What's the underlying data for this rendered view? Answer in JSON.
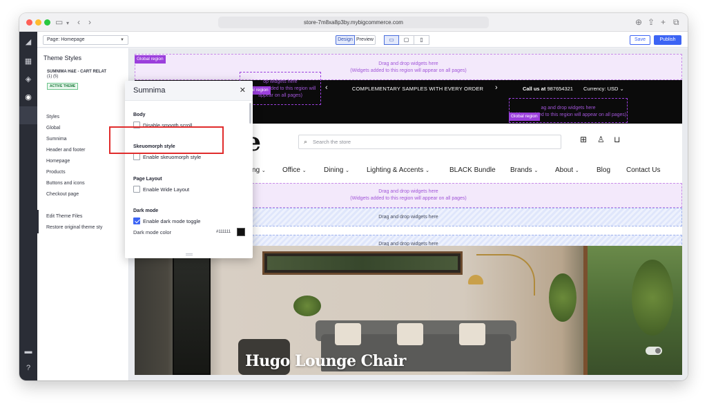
{
  "browser": {
    "url": "store-7m8xa8p3by.mybigcommerce.com"
  },
  "toolbar": {
    "page_select": "Page: Homepage",
    "design_label": "Design",
    "preview_label": "Preview",
    "save_label": "Save",
    "publish_label": "Publish"
  },
  "sidebar": {
    "title": "Theme Styles",
    "theme_name": "SUMNIMA H&E - CART RELAT",
    "theme_version": "(1) (5)",
    "active_badge": "ACTIVE THEME",
    "items": [
      "Styles",
      "Global",
      "Sumnima",
      "Header and footer",
      "Homepage",
      "Products",
      "Buttons and icons",
      "Checkout page"
    ],
    "edit_files": "Edit Theme Files",
    "restore": "Restore original theme sty"
  },
  "popup": {
    "title": "Sumnima",
    "sections": [
      {
        "title": "Body",
        "option": "Disable smooth scroll",
        "checked": false
      },
      {
        "title": "Skeuomorph style",
        "option": "Enable skeuomorph style",
        "checked": false
      },
      {
        "title": "Page Layout",
        "option": "Enable Wide Layout",
        "checked": false
      },
      {
        "title": "Dark mode",
        "option": "Enable dark mode toggle",
        "checked": true
      }
    ],
    "color_label": "Dark mode color",
    "color_hex": "#111111"
  },
  "store": {
    "global_region_label": "Global region",
    "drop_line1": "Drag and drop widgets here",
    "drop_line2": "(Widgets added to this region will appear on all pages)",
    "drop_small_1": "op widgets here",
    "drop_small_2": "(Widgets added to this region will",
    "drop_small_3": "appear on all pages)",
    "drop_right_1": "ag and drop widgets here",
    "drop_right_2": "(Widgets added to this region will appear on all pages)",
    "drop_plain": "Drag and drop widgets here",
    "promo": "COMPLEMENTARY SAMPLES WITH EVERY ORDER",
    "call_us_label": "Call us at",
    "phone": "987654321",
    "currency": "Currency: USD",
    "logo": "me",
    "search_placeholder": "Search the store",
    "nav": [
      "Living",
      "Office",
      "Dining",
      "Lighting & Accents",
      "BLACK Bundle",
      "Brands",
      "About",
      "Blog",
      "Contact Us"
    ],
    "hero_title": "Hugo Lounge Chair"
  },
  "colors": {
    "accent": "#3c64f4",
    "region_purple": "#9b3fdc",
    "highlight_red": "#e02b2b",
    "topbar": "#0b0b0b"
  }
}
